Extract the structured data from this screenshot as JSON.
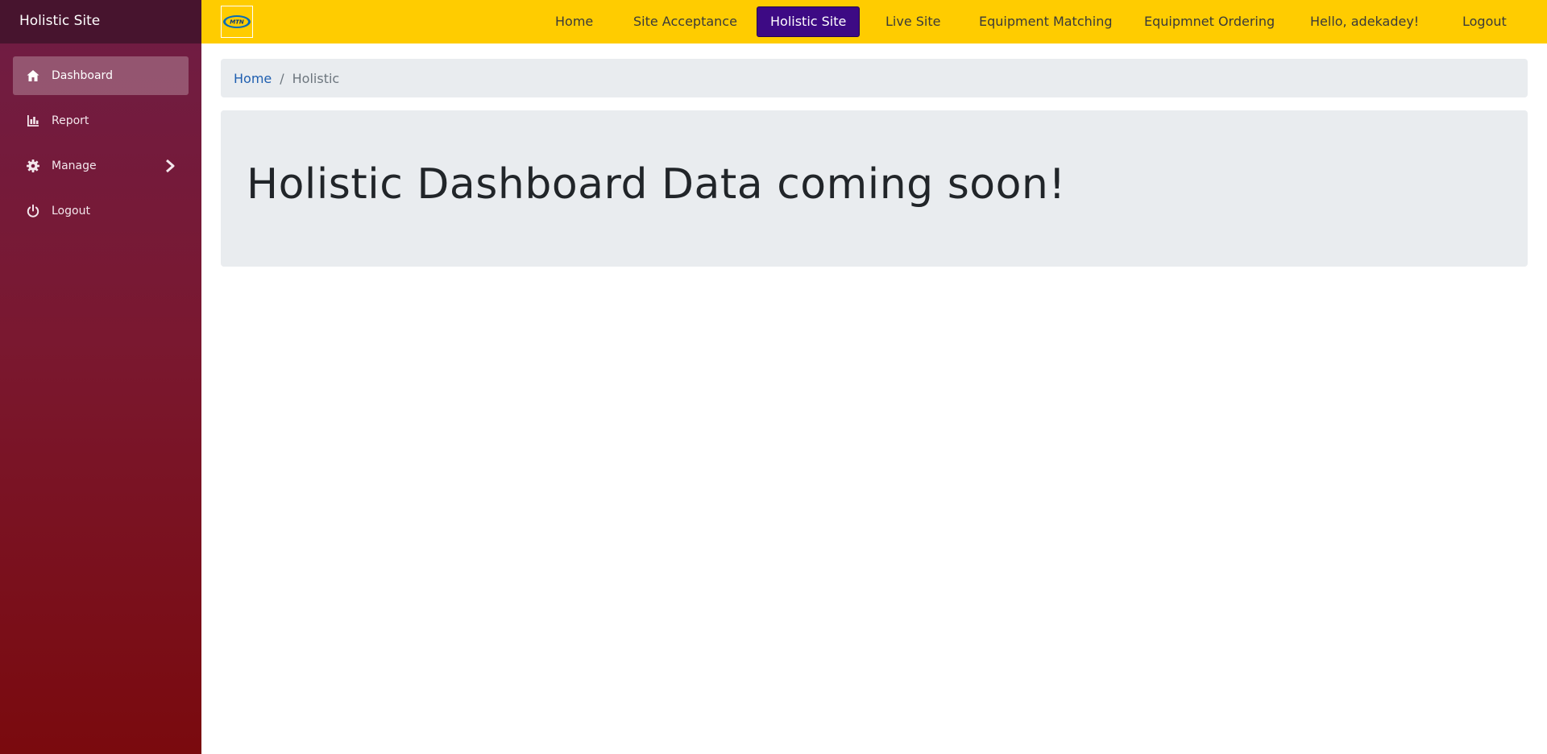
{
  "sidebar": {
    "brand": "Holistic Site",
    "items": [
      {
        "label": "Dashboard",
        "icon": "home-icon",
        "active": true
      },
      {
        "label": "Report",
        "icon": "bar-chart-icon"
      },
      {
        "label": "Manage",
        "icon": "gear-icon",
        "expandable": true
      },
      {
        "label": "Logout",
        "icon": "power-icon"
      }
    ]
  },
  "topnav": {
    "logo_text": "MTN",
    "links": [
      {
        "label": "Home"
      },
      {
        "label": "Site Acceptance"
      },
      {
        "label": "Holistic Site",
        "active": true
      },
      {
        "label": "Live Site"
      },
      {
        "label": "Equipment Matching"
      },
      {
        "label": "Equipmnet Ordering"
      },
      {
        "label": "Hello, adekadey!"
      },
      {
        "label": "Logout"
      }
    ]
  },
  "breadcrumb": {
    "home": "Home",
    "separator": "/",
    "current": "Holistic"
  },
  "main": {
    "headline": "Holistic Dashboard Data coming soon!"
  },
  "colors": {
    "topnav_bg": "#ffcc00",
    "active_nav_bg": "#3d0a84",
    "sidebar_top": "#6f1d45",
    "sidebar_bottom": "#7a0a0e"
  }
}
